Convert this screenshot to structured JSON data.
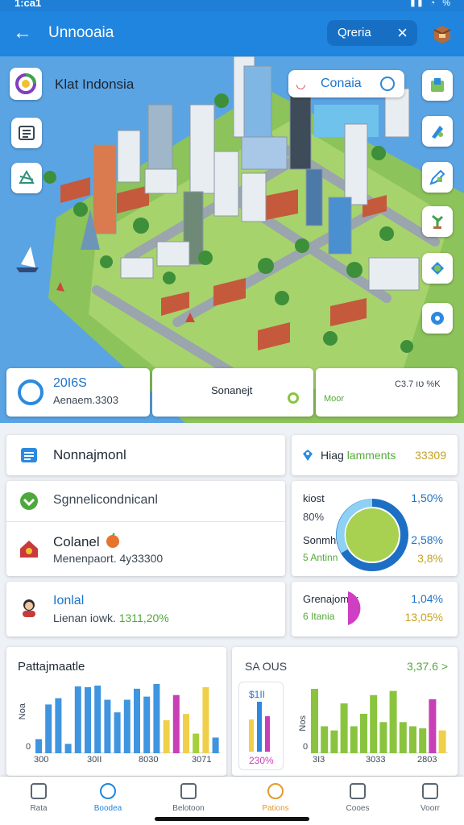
{
  "status_bar": {
    "time": "1:ca1",
    "icons": "▮▮ ◔ %"
  },
  "app_bar": {
    "back_icon": "arrow-left-icon",
    "title": "Unnooaia",
    "search_chip_label": "Qreria",
    "close_icon": "close-icon",
    "box_icon": "box-icon"
  },
  "map": {
    "title": "Klat Indonsia",
    "pill_label": "Conaia",
    "cards": [
      {
        "value": "20I6S",
        "sub": "Aenaem.3303"
      },
      {
        "text": "Sonanejt"
      },
      {
        "label": "Moor",
        "text": "Cטו 3.7 %K"
      }
    ]
  },
  "list": {
    "row1": "Nonnajmonl",
    "row2": "Sgnnelicondnicanl",
    "row3_title": "Colanel",
    "row3_sub": "Menenpaort. 4y33300",
    "row4_title": "Ionlal",
    "row4_sub_prefix": "Lienan iowk.",
    "row4_sub_value": "1311,20%"
  },
  "stats": {
    "header_label": "Hiag",
    "header_label_green": "lamments",
    "header_value": "33309",
    "k1": "kiost",
    "k2": "80%",
    "k3": "Sonmhir",
    "k4": "5 Antinn",
    "v1": "1,50%",
    "v2": "2,58%",
    "v3": "3,8%",
    "k5": "Grenajomar",
    "k6": "6 Itania",
    "v4": "1,04%",
    "v5": "13,05%"
  },
  "chart_left": {
    "title": "Pattajmaatle",
    "ylabel": "Noa",
    "y0": "0",
    "xticks": [
      "300",
      "30II",
      "8030",
      "3071"
    ]
  },
  "chart_right": {
    "title": "SA OUS",
    "total": "3,37.6 >",
    "mini_top": "$1II",
    "mini_bottom": "230%",
    "ylabel": "Nos",
    "y0": "0",
    "xticks": [
      "3I3",
      "3033",
      "2803"
    ]
  },
  "chart_data": [
    {
      "type": "bar",
      "title": "Pattajmaatle",
      "ylabel": "Noa",
      "x": [
        "300",
        "30II",
        "8030",
        "3071"
      ],
      "series": [
        {
          "values": [
            18,
            62,
            70,
            12,
            85,
            84,
            86,
            68,
            52,
            68,
            82,
            72,
            88,
            42,
            74,
            50,
            25,
            84,
            20
          ]
        }
      ],
      "colors": [
        "#3f95e0",
        "#f0d04a",
        "#c83fb6",
        "#a7cf3a"
      ]
    },
    {
      "type": "bar",
      "title": "SA OUS",
      "x": [
        "3I3",
        "3033",
        "2803"
      ],
      "series": [
        {
          "values": [
            62,
            26,
            22,
            48,
            26,
            38,
            56,
            30,
            60,
            30,
            26,
            24,
            52,
            22
          ]
        }
      ],
      "colors": [
        "#8ac43f",
        "#c83fb6",
        "#f0d04a"
      ]
    }
  ],
  "nav": [
    "Rata",
    "Boodea",
    "Belotoon",
    "Pations",
    "Cooes",
    "Voorr"
  ]
}
